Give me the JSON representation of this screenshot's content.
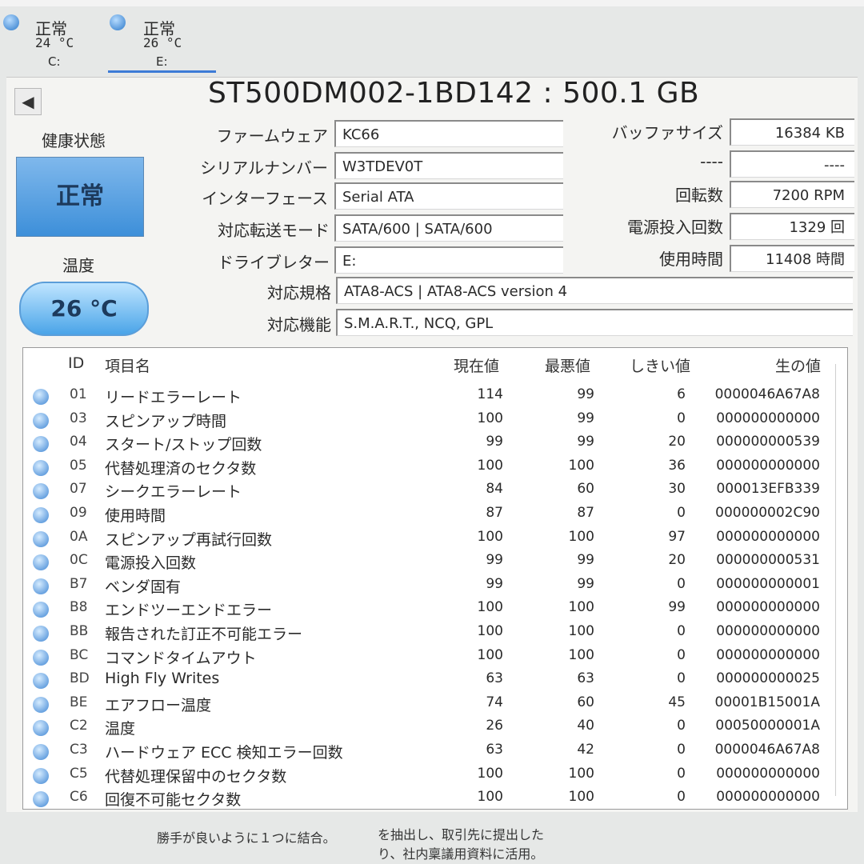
{
  "disks": [
    {
      "status": "正常",
      "temp": "24 °C",
      "letter": "C:"
    },
    {
      "status": "正常",
      "temp": "26 °C",
      "letter": "E:"
    }
  ],
  "drive": {
    "title": "ST500DM002-1BD142 : 500.1 GB",
    "health_label": "健康状態",
    "health_value": "正常",
    "temp_label": "温度",
    "temp_value": "26 °C"
  },
  "fields": {
    "firmware": {
      "label": "ファームウェア",
      "value": "KC66"
    },
    "serial": {
      "label": "シリアルナンバー",
      "value": "W3TDEV0T"
    },
    "interface": {
      "label": "インターフェース",
      "value": "Serial ATA"
    },
    "transfer": {
      "label": "対応転送モード",
      "value": "SATA/600 | SATA/600"
    },
    "drive_letter": {
      "label": "ドライブレター",
      "value": "E:"
    },
    "standard": {
      "label": "対応規格",
      "value": "ATA8-ACS | ATA8-ACS version 4"
    },
    "features": {
      "label": "対応機能",
      "value": "S.M.A.R.T., NCQ, GPL"
    },
    "buffer": {
      "label": "バッファサイズ",
      "value": "16384 KB"
    },
    "unknown": {
      "label": "----",
      "value": "----"
    },
    "rpm": {
      "label": "回転数",
      "value": "7200 RPM"
    },
    "power_count": {
      "label": "電源投入回数",
      "value": "1329 回"
    },
    "power_hours": {
      "label": "使用時間",
      "value": "11408 時間"
    }
  },
  "table": {
    "headers": {
      "id": "ID",
      "name": "項目名",
      "current": "現在値",
      "worst": "最悪値",
      "threshold": "しきい値",
      "raw": "生の値"
    },
    "rows": [
      {
        "id": "01",
        "name": "リードエラーレート",
        "current": "114",
        "worst": "99",
        "threshold": "6",
        "raw": "0000046A67A8"
      },
      {
        "id": "03",
        "name": "スピンアップ時間",
        "current": "100",
        "worst": "99",
        "threshold": "0",
        "raw": "000000000000"
      },
      {
        "id": "04",
        "name": "スタート/ストップ回数",
        "current": "99",
        "worst": "99",
        "threshold": "20",
        "raw": "000000000539"
      },
      {
        "id": "05",
        "name": "代替処理済のセクタ数",
        "current": "100",
        "worst": "100",
        "threshold": "36",
        "raw": "000000000000"
      },
      {
        "id": "07",
        "name": "シークエラーレート",
        "current": "84",
        "worst": "60",
        "threshold": "30",
        "raw": "000013EFB339"
      },
      {
        "id": "09",
        "name": "使用時間",
        "current": "87",
        "worst": "87",
        "threshold": "0",
        "raw": "000000002C90"
      },
      {
        "id": "0A",
        "name": "スピンアップ再試行回数",
        "current": "100",
        "worst": "100",
        "threshold": "97",
        "raw": "000000000000"
      },
      {
        "id": "0C",
        "name": "電源投入回数",
        "current": "99",
        "worst": "99",
        "threshold": "20",
        "raw": "000000000531"
      },
      {
        "id": "B7",
        "name": "ベンダ固有",
        "current": "99",
        "worst": "99",
        "threshold": "0",
        "raw": "000000000001"
      },
      {
        "id": "B8",
        "name": "エンドツーエンドエラー",
        "current": "100",
        "worst": "100",
        "threshold": "99",
        "raw": "000000000000"
      },
      {
        "id": "BB",
        "name": "報告された訂正不可能エラー",
        "current": "100",
        "worst": "100",
        "threshold": "0",
        "raw": "000000000000"
      },
      {
        "id": "BC",
        "name": "コマンドタイムアウト",
        "current": "100",
        "worst": "100",
        "threshold": "0",
        "raw": "000000000000"
      },
      {
        "id": "BD",
        "name": "High Fly Writes",
        "current": "63",
        "worst": "63",
        "threshold": "0",
        "raw": "000000000025"
      },
      {
        "id": "BE",
        "name": "エアフロー温度",
        "current": "74",
        "worst": "60",
        "threshold": "45",
        "raw": "00001B15001A"
      },
      {
        "id": "C2",
        "name": "温度",
        "current": "26",
        "worst": "40",
        "threshold": "0",
        "raw": "00050000001A"
      },
      {
        "id": "C3",
        "name": "ハードウェア ECC 検知エラー回数",
        "current": "63",
        "worst": "42",
        "threshold": "0",
        "raw": "0000046A67A8"
      },
      {
        "id": "C5",
        "name": "代替処理保留中のセクタ数",
        "current": "100",
        "worst": "100",
        "threshold": "0",
        "raw": "000000000000"
      },
      {
        "id": "C6",
        "name": "回復不可能セクタ数",
        "current": "100",
        "worst": "100",
        "threshold": "0",
        "raw": "000000000000"
      }
    ]
  },
  "background": {
    "line1": "勝手が良いように１つに結合。",
    "line2": "り、社内稟議用資料に活用。",
    "line3": "を抽出し、取引先に提出した"
  }
}
